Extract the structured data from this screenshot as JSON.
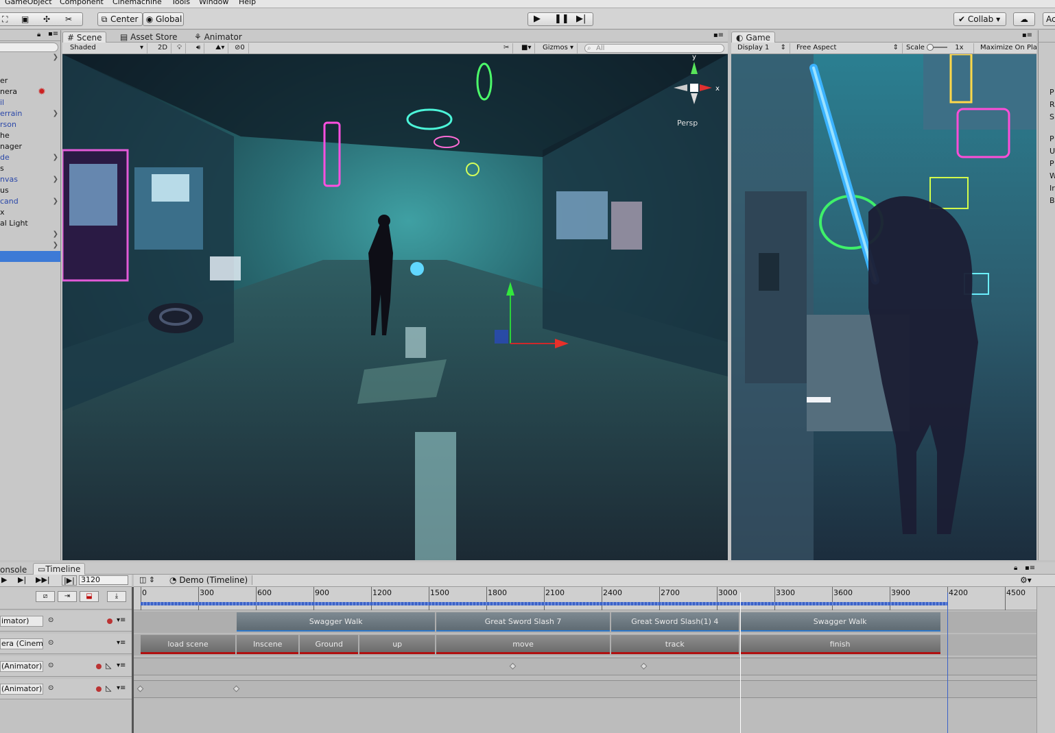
{
  "menubar": {
    "items": [
      "GameObject",
      "Component",
      "Cinemachine",
      "Tools",
      "Window",
      "Help"
    ]
  },
  "toolbar": {
    "pivot_label": "Center",
    "space_label": "Global",
    "collab_label": "Collab ▾",
    "account_label": "Ac"
  },
  "scene_tabs": {
    "scene": "Scene",
    "asset_store": "Asset Store",
    "animator": "Animator"
  },
  "scene_toolbar": {
    "shading": "Shaded",
    "mode_2d": "2D",
    "fx_count": "0",
    "gizmos": "Gizmos",
    "search_placeholder": "All",
    "persp": "Persp"
  },
  "game_tab": {
    "label": "Game"
  },
  "game_toolbar": {
    "display": "Display 1",
    "aspect": "Free Aspect",
    "scale_label": "Scale",
    "scale_value": "1x",
    "maximize": "Maximize On Pla"
  },
  "hierarchy": {
    "items": [
      {
        "text": "er",
        "blue": false,
        "chev": false
      },
      {
        "text": "nera",
        "blue": false,
        "chev": false
      },
      {
        "text": "il",
        "blue": true,
        "chev": false
      },
      {
        "text": "errain",
        "blue": true,
        "chev": true
      },
      {
        "text": "rson",
        "blue": true,
        "chev": false
      },
      {
        "text": "he",
        "blue": false,
        "chev": false
      },
      {
        "text": "nager",
        "blue": false,
        "chev": false
      },
      {
        "text": "de",
        "blue": true,
        "chev": true
      },
      {
        "text": "s",
        "blue": false,
        "chev": false
      },
      {
        "text": "nvas",
        "blue": true,
        "chev": true
      },
      {
        "text": "us",
        "blue": false,
        "chev": false
      },
      {
        "text": "cand",
        "blue": true,
        "chev": true
      },
      {
        "text": "x",
        "blue": false,
        "chev": false
      },
      {
        "text": "al Light",
        "blue": false,
        "chev": false
      },
      {
        "text": "",
        "blue": false,
        "chev": true
      },
      {
        "text": "",
        "blue": false,
        "chev": true
      }
    ]
  },
  "inspector": {
    "letters": [
      "P",
      "R",
      "S",
      "P",
      "U",
      "P",
      "W",
      "Ir",
      "B"
    ]
  },
  "timeline": {
    "console_tab": "onsole",
    "timeline_tab": "Timeline",
    "frame": "3120",
    "asset": "Demo (Timeline)",
    "ruler": [
      "0",
      "300",
      "600",
      "900",
      "1200",
      "1500",
      "1800",
      "2100",
      "2400",
      "2700",
      "3000",
      "3300",
      "3600",
      "3900",
      "4200",
      "4500"
    ],
    "playhead": 3120,
    "end": 4200,
    "tracks": [
      "imator)",
      "era (Cinem",
      "(Animator)",
      "(Animator)"
    ],
    "anim_clips": [
      {
        "label": "Swagger Walk",
        "start": 500,
        "end": 1540
      },
      {
        "label": "Great Sword Slash 7",
        "start": 1540,
        "end": 2450
      },
      {
        "label": "Great Sword Slash(1) 4",
        "start": 2450,
        "end": 3120
      },
      {
        "label": "Swagger Walk",
        "start": 3120,
        "end": 4170
      }
    ],
    "cine_clips": [
      {
        "label": "load scene",
        "start": 0,
        "end": 500
      },
      {
        "label": "Inscene",
        "start": 500,
        "end": 830
      },
      {
        "label": "Ground",
        "start": 830,
        "end": 1140
      },
      {
        "label": "up",
        "start": 1140,
        "end": 1540
      },
      {
        "label": "move",
        "start": 1540,
        "end": 2450
      },
      {
        "label": "track",
        "start": 2450,
        "end": 3120
      },
      {
        "label": "finish",
        "start": 3120,
        "end": 4170
      }
    ],
    "keys_track3": [
      1940,
      2620
    ],
    "keys_track4": [
      0,
      500
    ]
  },
  "colors": {
    "selection": "#3d7ad6",
    "clip_underline_anim": "#2e77c8",
    "clip_underline_cine": "#b01010",
    "playhead": "#ffffff"
  }
}
